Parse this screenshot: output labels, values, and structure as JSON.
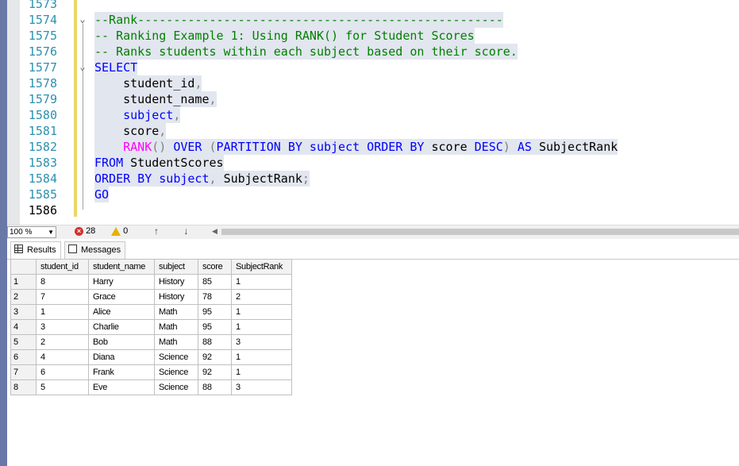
{
  "editor": {
    "lines": [
      {
        "num": "1573",
        "current": false,
        "fold": "",
        "parts": []
      },
      {
        "num": "1574",
        "current": false,
        "fold": "minus",
        "highlight": true,
        "parts": [
          {
            "c": "cm",
            "t": "--Rank---------------------------------------------------"
          }
        ]
      },
      {
        "num": "1575",
        "current": false,
        "fold": "",
        "highlight": true,
        "parts": [
          {
            "c": "cm",
            "t": "-- Ranking Example 1: Using RANK() for Student Scores"
          }
        ]
      },
      {
        "num": "1576",
        "current": false,
        "fold": "",
        "highlight": true,
        "parts": [
          {
            "c": "cm",
            "t": "-- Ranks students within each subject based on their score."
          }
        ]
      },
      {
        "num": "1577",
        "current": false,
        "fold": "minus",
        "highlight": true,
        "parts": [
          {
            "c": "kw",
            "t": "SELECT"
          }
        ]
      },
      {
        "num": "1578",
        "current": false,
        "fold": "",
        "highlight": true,
        "parts": [
          {
            "c": "tx",
            "t": "    student_id"
          },
          {
            "c": "gy",
            "t": ","
          }
        ]
      },
      {
        "num": "1579",
        "current": false,
        "fold": "",
        "highlight": true,
        "parts": [
          {
            "c": "tx",
            "t": "    student_name"
          },
          {
            "c": "gy",
            "t": ","
          }
        ]
      },
      {
        "num": "1580",
        "current": false,
        "fold": "",
        "highlight": true,
        "parts": [
          {
            "c": "kw",
            "t": "    subject"
          },
          {
            "c": "gy",
            "t": ","
          }
        ]
      },
      {
        "num": "1581",
        "current": false,
        "fold": "",
        "highlight": true,
        "parts": [
          {
            "c": "tx",
            "t": "    score"
          },
          {
            "c": "gy",
            "t": ","
          }
        ]
      },
      {
        "num": "1582",
        "current": false,
        "fold": "",
        "highlight": true,
        "parts": [
          {
            "c": "fn",
            "t": "    RANK"
          },
          {
            "c": "gy",
            "t": "() "
          },
          {
            "c": "kw",
            "t": "OVER "
          },
          {
            "c": "gy",
            "t": "("
          },
          {
            "c": "kw",
            "t": "PARTITION BY subject ORDER BY "
          },
          {
            "c": "tx",
            "t": "score "
          },
          {
            "c": "kw",
            "t": "DESC"
          },
          {
            "c": "gy",
            "t": ") "
          },
          {
            "c": "kw",
            "t": "AS "
          },
          {
            "c": "tx",
            "t": "SubjectRank"
          }
        ]
      },
      {
        "num": "1583",
        "current": false,
        "fold": "",
        "highlight": true,
        "parts": [
          {
            "c": "kw",
            "t": "FROM "
          },
          {
            "c": "tx",
            "t": "StudentScores"
          }
        ]
      },
      {
        "num": "1584",
        "current": false,
        "fold": "",
        "highlight": true,
        "parts": [
          {
            "c": "kw",
            "t": "ORDER BY subject"
          },
          {
            "c": "gy",
            "t": ", "
          },
          {
            "c": "tx",
            "t": "SubjectRank"
          },
          {
            "c": "gy",
            "t": ";"
          }
        ]
      },
      {
        "num": "1585",
        "current": false,
        "fold": "",
        "highlight": true,
        "parts": [
          {
            "c": "kw",
            "t": "GO"
          }
        ]
      },
      {
        "num": "1586",
        "current": true,
        "fold": "",
        "parts": []
      }
    ]
  },
  "statusbar": {
    "zoom": "100 %",
    "errors_count": "28",
    "warnings_count": "0",
    "nav_arrows": "↑ ↓",
    "scroll_left": "◀"
  },
  "results": {
    "tabs": [
      {
        "label": "Results",
        "icon": "grid-icon",
        "active": true
      },
      {
        "label": "Messages",
        "icon": "messages-icon",
        "active": false
      }
    ],
    "columns": [
      "student_id",
      "student_name",
      "subject",
      "score",
      "SubjectRank"
    ],
    "rows": [
      [
        "1",
        "8",
        "Harry",
        "History",
        "85",
        "1"
      ],
      [
        "2",
        "7",
        "Grace",
        "History",
        "78",
        "2"
      ],
      [
        "3",
        "1",
        "Alice",
        "Math",
        "95",
        "1"
      ],
      [
        "4",
        "3",
        "Charlie",
        "Math",
        "95",
        "1"
      ],
      [
        "5",
        "2",
        "Bob",
        "Math",
        "88",
        "3"
      ],
      [
        "6",
        "4",
        "Diana",
        "Science",
        "92",
        "1"
      ],
      [
        "7",
        "6",
        "Frank",
        "Science",
        "92",
        "1"
      ],
      [
        "8",
        "5",
        "Eve",
        "Science",
        "88",
        "3"
      ]
    ]
  }
}
